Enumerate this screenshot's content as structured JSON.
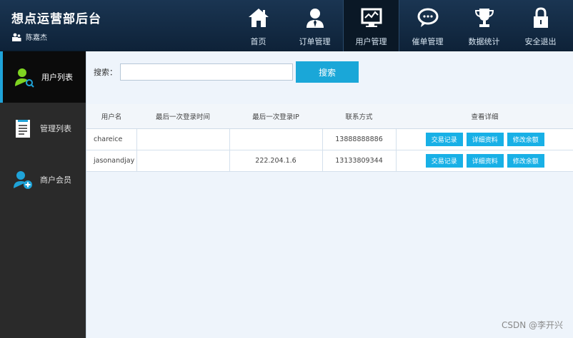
{
  "app": {
    "title": "想点运营部后台",
    "user": "陈嘉杰"
  },
  "nav": {
    "items": [
      {
        "label": "首页",
        "icon": "home-icon"
      },
      {
        "label": "订单管理",
        "icon": "person-tie-icon"
      },
      {
        "label": "用户管理",
        "icon": "monitor-chart-icon",
        "active": true
      },
      {
        "label": "催单管理",
        "icon": "chat-bubble-icon"
      },
      {
        "label": "数据统计",
        "icon": "trophy-icon"
      },
      {
        "label": "安全退出",
        "icon": "lock-icon"
      }
    ]
  },
  "sidebar": {
    "items": [
      {
        "label": "用户列表",
        "icon": "user-search-icon",
        "active": true
      },
      {
        "label": "管理列表",
        "icon": "document-icon"
      },
      {
        "label": "商户会员",
        "icon": "user-add-icon"
      }
    ]
  },
  "search": {
    "label": "搜索：",
    "value": "",
    "placeholder": "",
    "button_label": "搜索"
  },
  "table": {
    "headers": [
      "用户名",
      "最后一次登录时间",
      "最后一次登录IP",
      "联系方式",
      "查看详细"
    ],
    "actions": [
      "交易记录",
      "详细资料",
      "修改余额"
    ],
    "rows": [
      {
        "name": "chareice",
        "time": "",
        "ip": "",
        "phone": "13888888886"
      },
      {
        "name": "jasonandjay",
        "time": "",
        "ip": "222.204.1.6",
        "phone": "13133809344"
      }
    ]
  },
  "watermark": "CSDN @李开兴",
  "colors": {
    "header_bg": "#12283f",
    "accent": "#1aa7d8",
    "sidebar_bg": "#2a2a2a"
  }
}
